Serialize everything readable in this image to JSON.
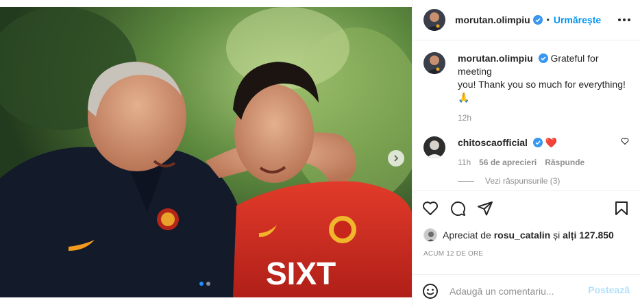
{
  "post": {
    "author": "morutan.olimpiu",
    "follow_label": "Urmărește",
    "separator": "•",
    "caption_line1": "Grateful for meeting",
    "caption_line2": "you! Thank you so much for everything!",
    "caption_emoji": "🙏",
    "caption_time": "12h"
  },
  "comment": {
    "author": "chitoscaofficial",
    "emoji": "❤️",
    "time": "11h",
    "likes": "56 de aprecieri",
    "reply_label": "Răspunde",
    "view_replies": "Vezi răspunsurile (3)"
  },
  "likes": {
    "prefix": "Apreciat de",
    "user": "rosu_catalin",
    "connector": "și",
    "others": "alți 127.850"
  },
  "time_ago": "ACUM 12 DE ORE",
  "add_comment": {
    "placeholder": "Adaugă un comentariu...",
    "post_label": "Postează"
  },
  "carousel": {
    "slides": 2,
    "active": 1
  },
  "colors": {
    "accent": "#0095f6",
    "verified": "#3897f0",
    "like_red": "#ed4956",
    "post_disabled": "#b2dffc"
  },
  "icons": [
    "verified-badge-icon",
    "more-options-icon",
    "heart-icon",
    "comment-icon",
    "share-icon",
    "save-icon",
    "emoji-icon",
    "chevron-right-icon"
  ]
}
